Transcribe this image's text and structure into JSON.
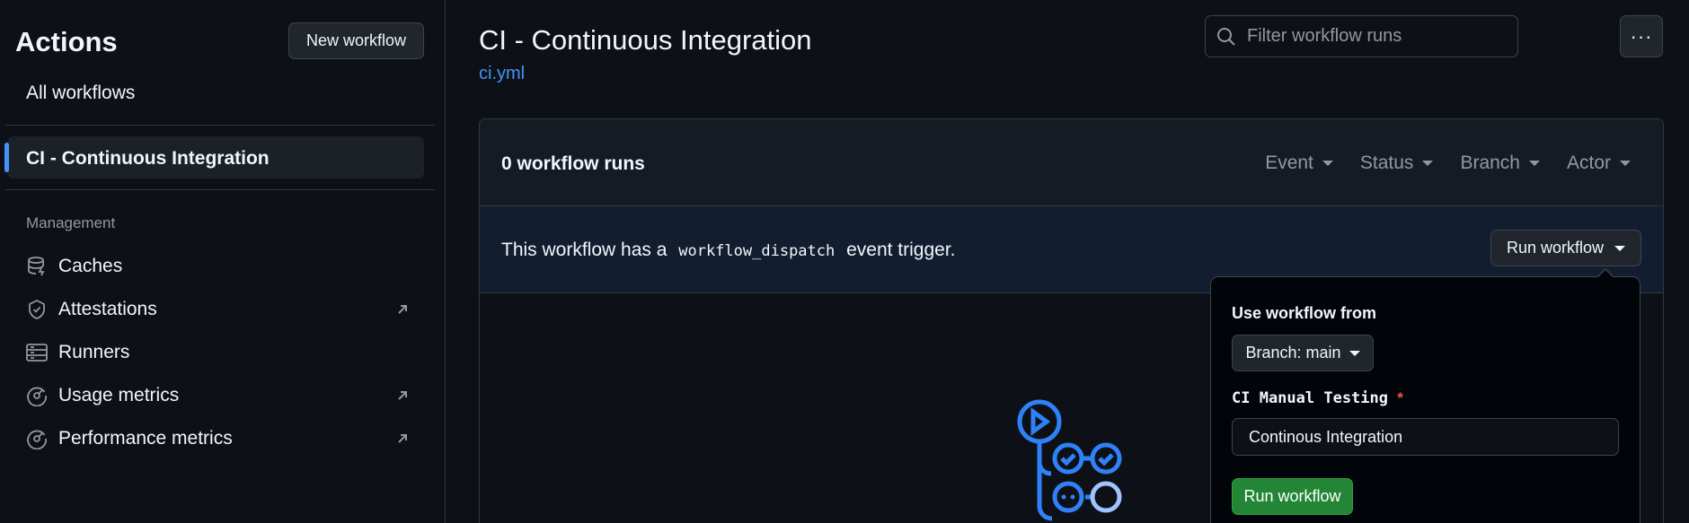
{
  "sidebar": {
    "title": "Actions",
    "new_workflow": "New workflow",
    "all_workflows": "All workflows",
    "active_workflow": "CI - Continuous Integration",
    "section": "Management",
    "items": [
      {
        "label": "Caches",
        "icon": "database-icon",
        "external": false
      },
      {
        "label": "Attestations",
        "icon": "verified-shield-icon",
        "external": true
      },
      {
        "label": "Runners",
        "icon": "server-icon",
        "external": false
      },
      {
        "label": "Usage metrics",
        "icon": "meter-icon",
        "external": true
      },
      {
        "label": "Performance metrics",
        "icon": "meter-icon",
        "external": true
      }
    ]
  },
  "header": {
    "title": "CI - Continuous Integration",
    "file": "ci.yml",
    "search_placeholder": "Filter workflow runs",
    "more": "···"
  },
  "runs": {
    "count_label": "0 workflow runs",
    "filters": [
      "Event",
      "Status",
      "Branch",
      "Actor"
    ]
  },
  "dispatch": {
    "text_before": "This workflow has a",
    "code": "workflow_dispatch",
    "text_after": "event trigger.",
    "button": "Run workflow"
  },
  "popover": {
    "use_from_label": "Use workflow from",
    "branch_button": "Branch: main",
    "input_label": "CI Manual Testing",
    "required_mark": "*",
    "input_value": "Continous Integration",
    "submit": "Run workflow"
  },
  "colors": {
    "background": "#0d1117",
    "accent": "#4493f8",
    "success": "#238636",
    "danger": "#f85149"
  }
}
